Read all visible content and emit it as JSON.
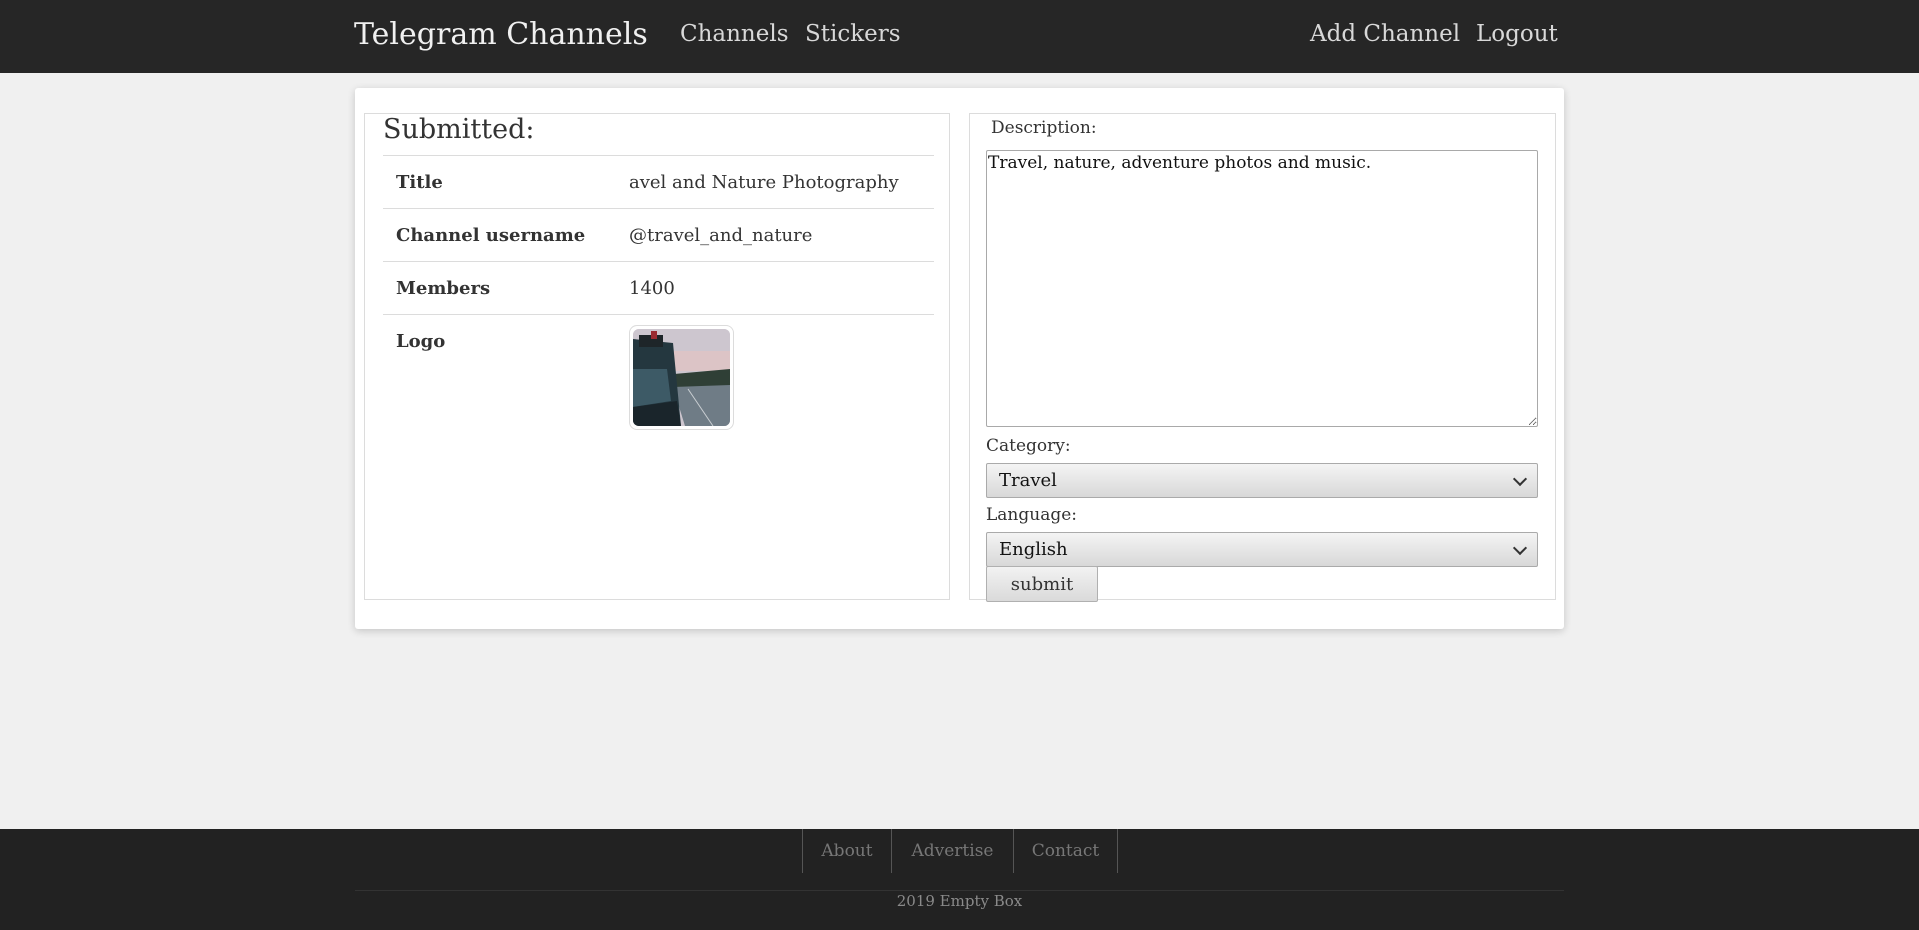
{
  "navbar": {
    "brand": "Telegram Channels",
    "links": [
      "Channels",
      "Stickers"
    ],
    "right_links": [
      "Add Channel",
      "Logout"
    ]
  },
  "submitted": {
    "heading": "Submitted:",
    "rows": [
      {
        "key": "Title",
        "value": "avel and Nature Photography"
      },
      {
        "key": "Channel username",
        "value": "@travel_and_nature"
      },
      {
        "key": "Members",
        "value": "1400"
      },
      {
        "key": "Logo",
        "value": ""
      }
    ]
  },
  "form": {
    "description_label": "Description:",
    "description_value": "Travel, nature, adventure photos and music.",
    "category_label": "Category:",
    "category_value": "Travel",
    "language_label": "Language:",
    "language_value": "English",
    "submit_label": "submit"
  },
  "footer": {
    "links": [
      "About",
      "Advertise",
      "Contact"
    ],
    "copyright": "2019 Empty Box"
  },
  "colors": {
    "navbar_bg": "#262626",
    "footer_bg": "#222222",
    "page_bg": "#f0f0f0"
  }
}
